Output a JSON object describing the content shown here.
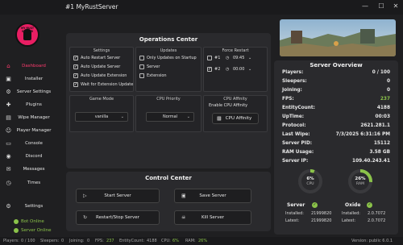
{
  "window": {
    "title": "#1 MyRustServer",
    "btn_min": "—",
    "btn_max": "☐",
    "btn_close": "✕"
  },
  "logo": {
    "text": "MY RUST SERVER"
  },
  "sidebar": {
    "items": [
      {
        "label": "Dashboard",
        "icon": "⌂"
      },
      {
        "label": "Installer",
        "icon": "▣"
      },
      {
        "label": "Server Settings",
        "icon": "⚙"
      },
      {
        "label": "Plugins",
        "icon": "✚"
      },
      {
        "label": "Wipe Manager",
        "icon": "▤"
      },
      {
        "label": "Player Manager",
        "icon": "☺"
      },
      {
        "label": "Console",
        "icon": "▭"
      },
      {
        "label": "Discord",
        "icon": "◉"
      },
      {
        "label": "Messages",
        "icon": "✉"
      },
      {
        "label": "Times",
        "icon": "◷"
      },
      {
        "label": "Settings",
        "icon": "⚙"
      }
    ],
    "bot_status": "Bot Online",
    "server_status": "Server Online"
  },
  "operations": {
    "title": "Operations Center",
    "settings": {
      "title": "Settings",
      "options": [
        "Auto Restart Server",
        "Auto Update Server",
        "Auto Update Extension",
        "Wait for Extension Update"
      ]
    },
    "updates": {
      "title": "Updates",
      "options": [
        "Only Updates on Startup",
        "Server",
        "Extension"
      ]
    },
    "force_restart": {
      "title": "Force Restart",
      "row1": {
        "tag": "#1",
        "time": "09:45"
      },
      "row2": {
        "tag": "#2",
        "time": "00:00"
      }
    },
    "game_mode": {
      "title": "Game Mode",
      "value": "vanilla"
    },
    "cpu_priority": {
      "title": "CPU Priority",
      "value": "Normal"
    },
    "cpu_affinity": {
      "title": "CPU Affinity",
      "checkbox": "Enable CPU Affinity",
      "button": "CPU Affinity"
    }
  },
  "control": {
    "title": "Control Center",
    "start": "Start Server",
    "save": "Save Server",
    "restart_stop": "Restart/Stop Server",
    "kill": "Kill Server"
  },
  "overview": {
    "title": "Server Overview",
    "rows": [
      {
        "label": "Players:",
        "value": "0 / 100"
      },
      {
        "label": "Sleepers:",
        "value": "0"
      },
      {
        "label": "Joining:",
        "value": "0"
      },
      {
        "label": "FPS:",
        "value": "237",
        "green": true
      },
      {
        "label": "EntityCount:",
        "value": "4188"
      },
      {
        "label": "UpTime:",
        "value": "00:03"
      },
      {
        "label": "Protocol:",
        "value": "2621.281.1"
      },
      {
        "label": "Last Wipe:",
        "value": "7/3/2025 6:31:16 PM"
      },
      {
        "label": "Server PID:",
        "value": "15112"
      },
      {
        "label": "RAM Usage:",
        "value": "3.58 GB"
      },
      {
        "label": "Server IP:",
        "value": "109.40.243.41"
      }
    ],
    "cpu": {
      "value": "6%",
      "label": "CPU",
      "percent": 6
    },
    "ram": {
      "value": "26%",
      "label": "RAM",
      "percent": 26
    },
    "server_ver": {
      "title": "Server",
      "installed_label": "Installed:",
      "installed": "21999820",
      "latest_label": "Latest:",
      "latest": "21999820"
    },
    "oxide_ver": {
      "title": "Oxide",
      "installed_label": "Installed:",
      "installed": "2.0.7072",
      "latest_label": "Latest:",
      "latest": "2.0.7072"
    }
  },
  "footer": {
    "players_label": "Players:",
    "players": "0 / 100",
    "sleepers_label": "Sleepers:",
    "sleepers": "0",
    "joining_label": "Joining:",
    "joining": "0",
    "fps_label": "FPS:",
    "fps": "237",
    "entity_label": "EntityCount:",
    "entity": "4188",
    "cpu_label": "CPU:",
    "cpu": "6%",
    "ram_label": "RAM:",
    "ram": "26%",
    "version": "Version: public 6.0.1"
  },
  "colors": {
    "accent": "#ff3b6e",
    "green": "#8bc34a",
    "panel": "#2a2a2d",
    "gauge_track": "#3a3a3d"
  }
}
